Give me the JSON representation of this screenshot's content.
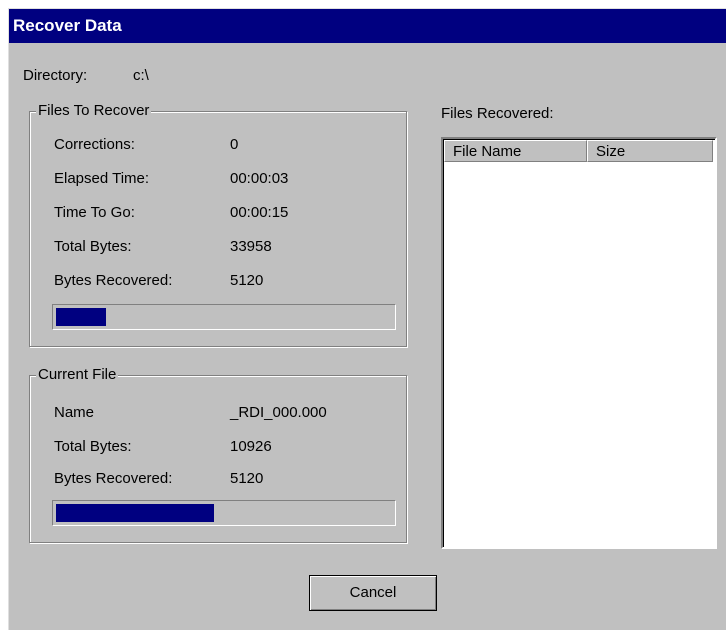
{
  "window": {
    "title": "Recover Data"
  },
  "directory": {
    "label": "Directory:",
    "value": "c:\\"
  },
  "files_to_recover": {
    "title": "Files To Recover",
    "rows": [
      {
        "label": "Corrections:",
        "value": "0"
      },
      {
        "label": "Elapsed Time:",
        "value": "00:00:03"
      },
      {
        "label": "Time To Go:",
        "value": "00:00:15"
      },
      {
        "label": "Total Bytes:",
        "value": "33958"
      },
      {
        "label": "Bytes Recovered:",
        "value": "5120"
      }
    ],
    "progress_fraction": 0.15
  },
  "current_file": {
    "title": "Current File",
    "rows": [
      {
        "label": "Name",
        "value": "_RDI_000.000"
      },
      {
        "label": "Total Bytes:",
        "value": "10926"
      },
      {
        "label": "Bytes Recovered:",
        "value": "5120"
      }
    ],
    "progress_fraction": 0.47
  },
  "files_recovered": {
    "label": "Files Recovered:",
    "columns": [
      "File Name",
      "Size"
    ],
    "items": []
  },
  "buttons": {
    "cancel_label": "Cancel"
  },
  "colors": {
    "title_bar": "#000080",
    "progress_fill": "#000080",
    "face": "#c0c0c0"
  }
}
